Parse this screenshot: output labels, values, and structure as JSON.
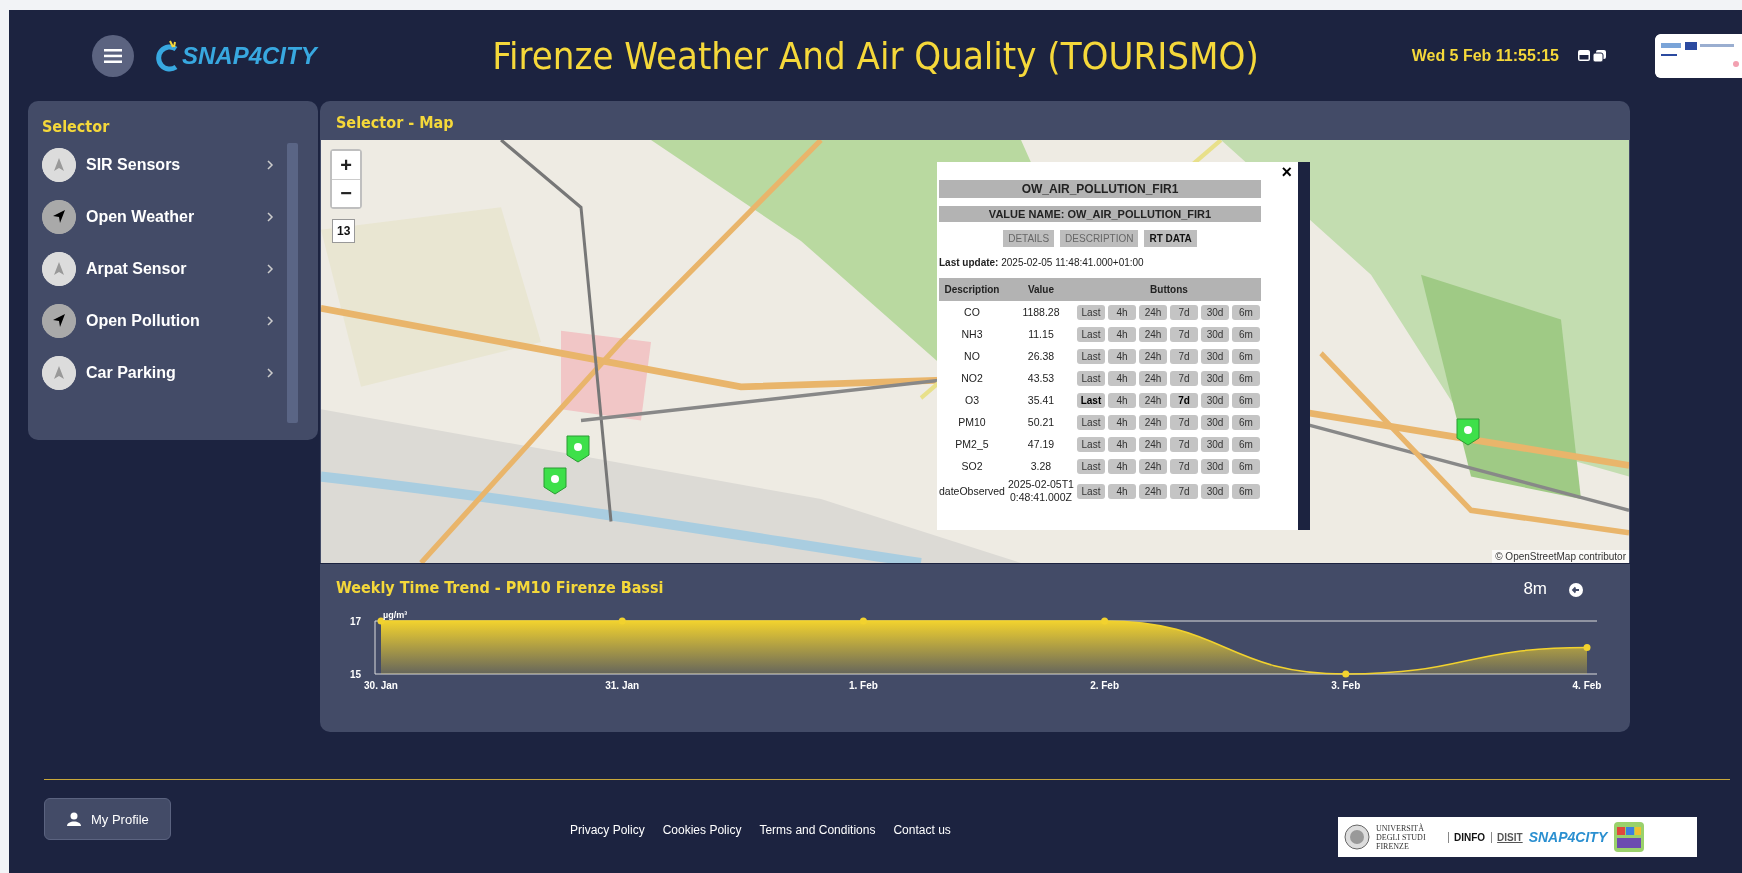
{
  "header": {
    "title": "Firenze Weather And Air Quality (TOURISMO)",
    "logo": "SNAP4CITY",
    "datetime": "Wed 5 Feb 11:55:15"
  },
  "selector": {
    "title": "Selector",
    "items": [
      {
        "label": "SIR Sensors",
        "kind": "triangle"
      },
      {
        "label": "Open Weather",
        "kind": "pointer"
      },
      {
        "label": "Arpat Sensor",
        "kind": "triangle"
      },
      {
        "label": "Open Pollution",
        "kind": "pointer"
      },
      {
        "label": "Car Parking",
        "kind": "triangle"
      }
    ]
  },
  "map": {
    "title": "Selector - Map",
    "zoom_in": "+",
    "zoom_out": "−",
    "zoom_level": "13",
    "attribution": "© OpenStreetMap contributor",
    "popup": {
      "close": "×",
      "title": "OW_AIR_POLLUTION_FIR1",
      "value_name": "VALUE NAME: OW_AIR_POLLUTION_FIR1",
      "tabs": [
        {
          "label": "DETAILS",
          "selected": false
        },
        {
          "label": "DESCRIPTION",
          "selected": false
        },
        {
          "label": "RT DATA",
          "selected": true
        }
      ],
      "last_update_label": "Last update:",
      "last_update": "2025-02-05 11:48:41.000+01:00",
      "columns": [
        "Description",
        "Value",
        "Buttons"
      ],
      "rows": [
        {
          "description": "CO",
          "value": "1188.28",
          "buttons": [
            {
              "label": "Last",
              "active": false
            },
            {
              "label": "4h",
              "active": false
            },
            {
              "label": "24h",
              "active": false
            },
            {
              "label": "7d",
              "active": false
            },
            {
              "label": "30d",
              "active": false
            },
            {
              "label": "6m",
              "active": false
            }
          ]
        },
        {
          "description": "NH3",
          "value": "11.15",
          "buttons": [
            {
              "label": "Last",
              "active": false
            },
            {
              "label": "4h",
              "active": false
            },
            {
              "label": "24h",
              "active": false
            },
            {
              "label": "7d",
              "active": false
            },
            {
              "label": "30d",
              "active": false
            },
            {
              "label": "6m",
              "active": false
            }
          ]
        },
        {
          "description": "NO",
          "value": "26.38",
          "buttons": [
            {
              "label": "Last",
              "active": false
            },
            {
              "label": "4h",
              "active": false
            },
            {
              "label": "24h",
              "active": false
            },
            {
              "label": "7d",
              "active": false
            },
            {
              "label": "30d",
              "active": false
            },
            {
              "label": "6m",
              "active": false
            }
          ]
        },
        {
          "description": "NO2",
          "value": "43.53",
          "buttons": [
            {
              "label": "Last",
              "active": false
            },
            {
              "label": "4h",
              "active": false
            },
            {
              "label": "24h",
              "active": false
            },
            {
              "label": "7d",
              "active": false
            },
            {
              "label": "30d",
              "active": false
            },
            {
              "label": "6m",
              "active": false
            }
          ]
        },
        {
          "description": "O3",
          "value": "35.41",
          "buttons": [
            {
              "label": "Last",
              "active": true
            },
            {
              "label": "4h",
              "active": false
            },
            {
              "label": "24h",
              "active": false
            },
            {
              "label": "7d",
              "active": true
            },
            {
              "label": "30d",
              "active": false
            },
            {
              "label": "6m",
              "active": false
            }
          ]
        },
        {
          "description": "PM10",
          "value": "50.21",
          "buttons": [
            {
              "label": "Last",
              "active": false
            },
            {
              "label": "4h",
              "active": false
            },
            {
              "label": "24h",
              "active": false
            },
            {
              "label": "7d",
              "active": false
            },
            {
              "label": "30d",
              "active": false
            },
            {
              "label": "6m",
              "active": false
            }
          ]
        },
        {
          "description": "PM2_5",
          "value": "47.19",
          "buttons": [
            {
              "label": "Last",
              "active": false
            },
            {
              "label": "4h",
              "active": false
            },
            {
              "label": "24h",
              "active": false
            },
            {
              "label": "7d",
              "active": false
            },
            {
              "label": "30d",
              "active": false
            },
            {
              "label": "6m",
              "active": false
            }
          ]
        },
        {
          "description": "SO2",
          "value": "3.28",
          "buttons": [
            {
              "label": "Last",
              "active": false
            },
            {
              "label": "4h",
              "active": false
            },
            {
              "label": "24h",
              "active": false
            },
            {
              "label": "7d",
              "active": false
            },
            {
              "label": "30d",
              "active": false
            },
            {
              "label": "6m",
              "active": false
            }
          ]
        },
        {
          "description": "dateObserved",
          "value": "2025-02-05T10:48:41.000Z",
          "buttons": [
            {
              "label": "Last",
              "active": false
            },
            {
              "label": "4h",
              "active": false
            },
            {
              "label": "24h",
              "active": false
            },
            {
              "label": "7d",
              "active": false
            },
            {
              "label": "30d",
              "active": false
            },
            {
              "label": "6m",
              "active": false
            }
          ]
        }
      ]
    }
  },
  "trend": {
    "range": "8m",
    "chart_data": {
      "type": "area",
      "title": "Weekly Time Trend - PM10 Firenze Bassi",
      "ylabel": "µg/m³",
      "categories": [
        "30. Jan",
        "31. Jan",
        "1. Feb",
        "2. Feb",
        "3. Feb",
        "4. Feb"
      ],
      "series": [
        {
          "color": "#f2d22e",
          "values": [
            17,
            17,
            17,
            17,
            15,
            16
          ]
        }
      ],
      "ylim": [
        15,
        17
      ],
      "yticks": [
        15,
        17
      ]
    }
  },
  "footer": {
    "profile": "My Profile",
    "links": [
      "Privacy Policy",
      "Cookies Policy",
      "Terms and Conditions",
      "Contact us"
    ],
    "logos": [
      "UNIVERSITÀ DEGLI STUDI FIRENZE",
      "DINFO",
      "DISIT",
      "SNAP4CITY"
    ]
  }
}
